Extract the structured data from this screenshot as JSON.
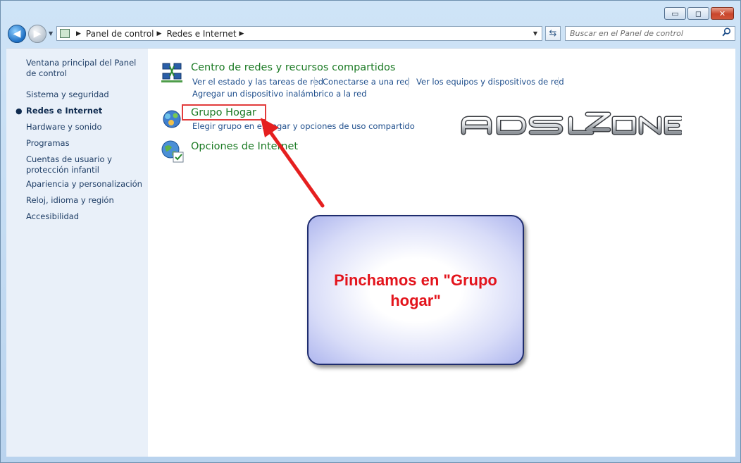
{
  "window": {
    "controls": {
      "minimize": "▭",
      "maximize": "◻",
      "close": "✕"
    }
  },
  "toolbar": {
    "breadcrumb": [
      "Panel de control",
      "Redes e Internet"
    ],
    "search_placeholder": "Buscar en el Panel de control"
  },
  "sidebar": {
    "items": [
      {
        "label": "Ventana principal del Panel de control",
        "current": false
      },
      {
        "label": "Sistema y seguridad",
        "current": false
      },
      {
        "label": "Redes e Internet",
        "current": true
      },
      {
        "label": "Hardware y sonido",
        "current": false
      },
      {
        "label": "Programas",
        "current": false
      },
      {
        "label": "Cuentas de usuario y protección infantil",
        "current": false
      },
      {
        "label": "Apariencia y personalización",
        "current": false
      },
      {
        "label": "Reloj, idioma y región",
        "current": false
      },
      {
        "label": "Accesibilidad",
        "current": false
      }
    ]
  },
  "categories": [
    {
      "title": "Centro de redes y recursos compartidos",
      "icon": "network-center-icon",
      "tasks": [
        "Ver el estado y las tareas de red",
        "Conectarse a una red",
        "Ver los equipos y dispositivos de red",
        "Agregar un dispositivo inalámbrico a la red"
      ]
    },
    {
      "title": "Grupo Hogar",
      "icon": "homegroup-icon",
      "tasks": [
        "Elegir grupo en el hogar y opciones de uso compartido"
      ]
    },
    {
      "title": "Opciones de Internet",
      "icon": "internet-options-icon",
      "tasks": []
    }
  ],
  "annotation": {
    "callout_text": "Pinchamos en \"Grupo hogar\"",
    "highlight_color": "#e23b3b",
    "text_color": "#e3141c"
  },
  "watermark": {
    "text": "ADSLZONE"
  },
  "colors": {
    "category_title": "#1b7a24",
    "task_link": "#1e4e8c",
    "sidebar_bg": "#e9f0f9"
  }
}
